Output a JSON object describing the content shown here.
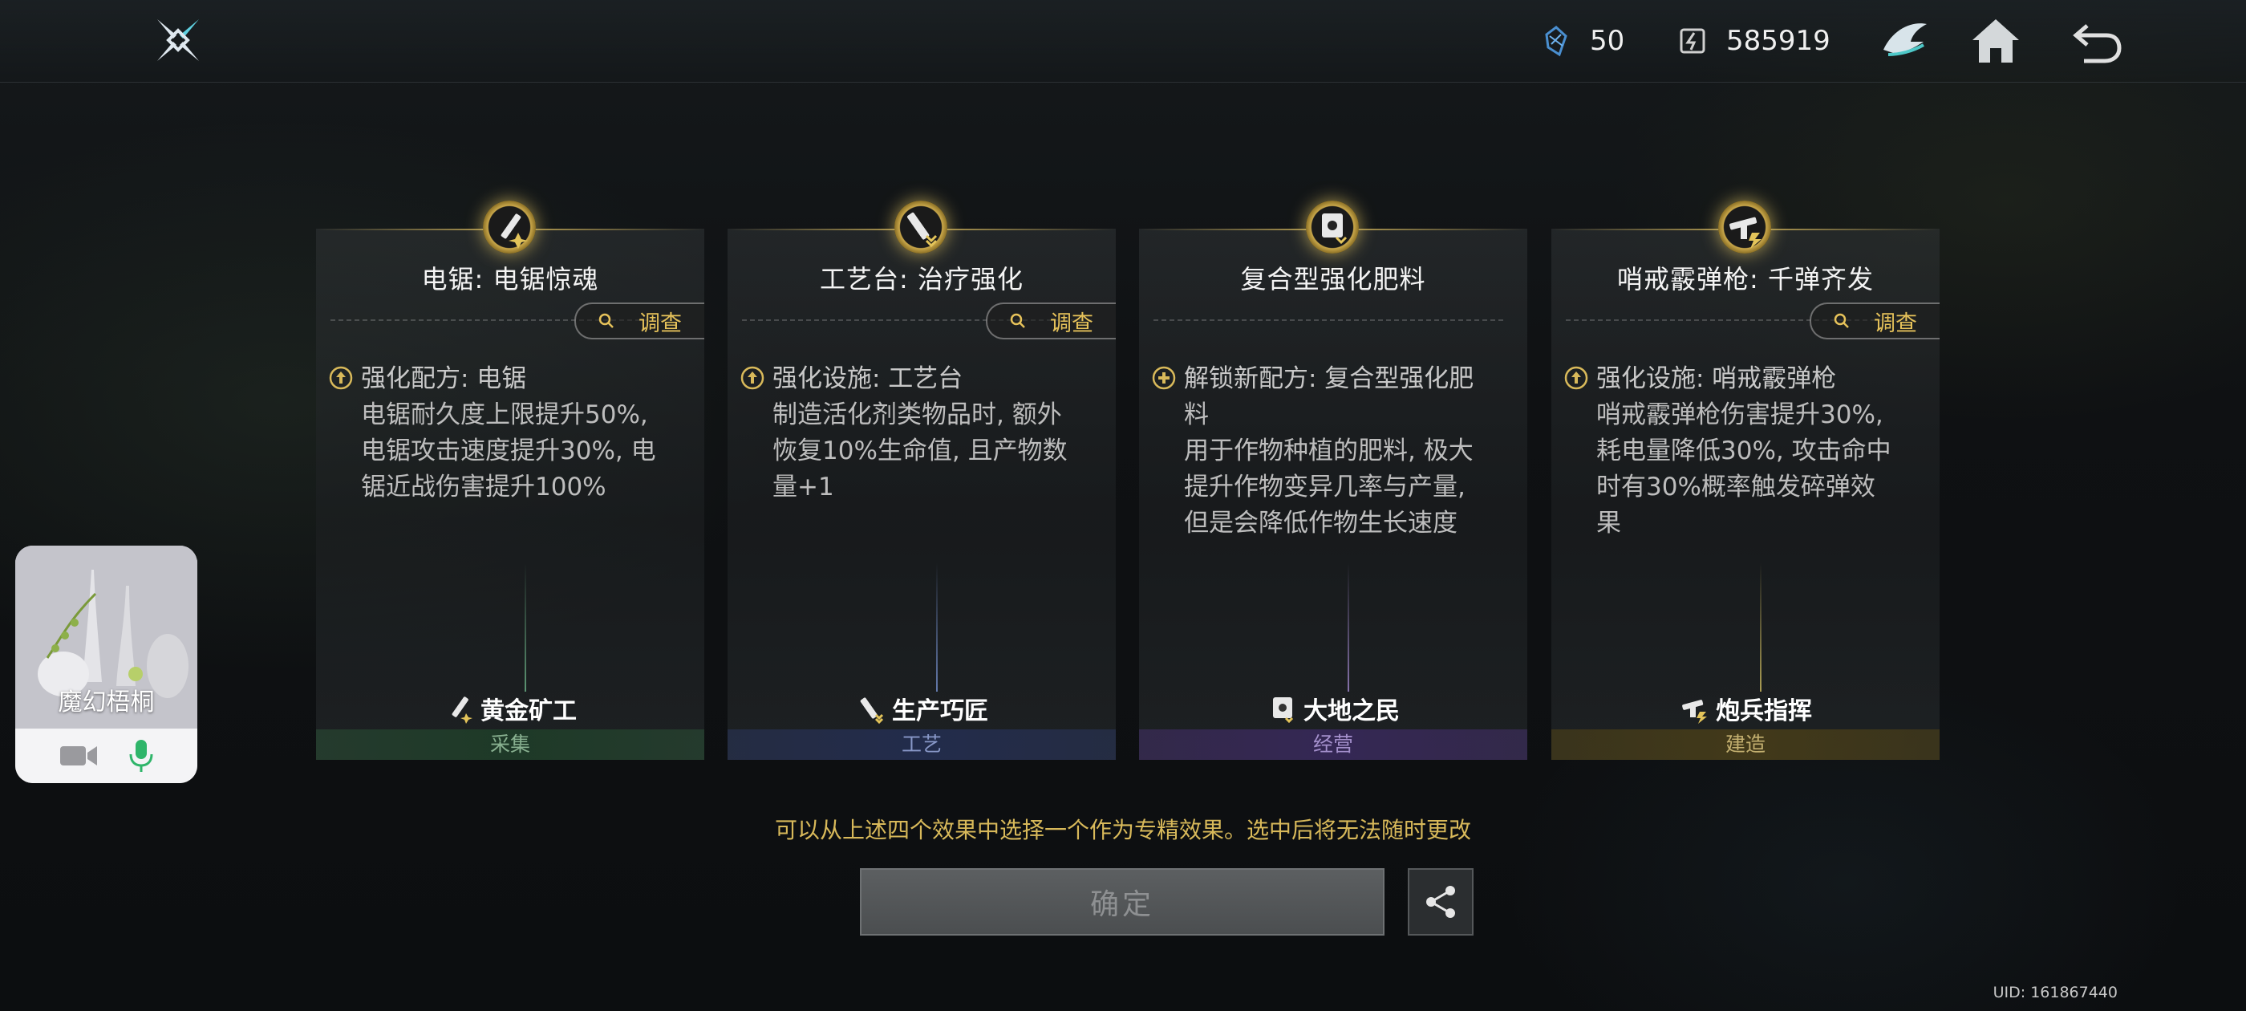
{
  "topbar": {
    "resource1_value": "50",
    "resource2_value": "585919"
  },
  "cards": [
    {
      "title": "电锯: 电锯惊魂",
      "investigate_label": "调查",
      "effect_head": "强化配方: 电锯",
      "effect_lines": [
        "电锯耐久度上限提升50%,",
        "电锯攻击速度提升30%, 电",
        "锯近战伤害提升100%"
      ],
      "role": "黄金矿工",
      "category": "采集",
      "category_color": "#88b090"
    },
    {
      "title": "工艺台: 治疗强化",
      "investigate_label": "调查",
      "effect_head": "强化设施: 工艺台",
      "effect_lines": [
        "制造活化剂类物品时, 额外",
        "恢复10%生命值, 且产物数",
        "量+1"
      ],
      "role": "生产巧匠",
      "category": "工艺",
      "category_color": "#8898c8"
    },
    {
      "title": "复合型强化肥料",
      "effect_head": "解锁新配方: 复合型强化肥",
      "effect_lines": [
        "料",
        "用于作物种植的肥料, 极大",
        "提升作物变异几率与产量,",
        "但是会降低作物生长速度"
      ],
      "role": "大地之民",
      "category": "经营",
      "category_color": "#a490cc"
    },
    {
      "title": "哨戒霰弹枪: 千弹齐发",
      "investigate_label": "调查",
      "effect_head": "强化设施: 哨戒霰弹枪",
      "effect_lines": [
        "哨戒霰弹枪伤害提升30%,",
        "耗电量降低30%, 攻击命中",
        "时有30%概率触发碎弹效",
        "果"
      ],
      "role": "炮兵指挥",
      "category": "建造",
      "category_color": "#c4b070"
    }
  ],
  "notice": "可以从上述四个效果中选择一个作为专精效果。选中后将无法随时更改",
  "confirm_label": "确定",
  "uid": "UID: 161867440",
  "call_widget": {
    "name": "魔幻梧桐"
  },
  "colors": {
    "accent_gold": "#d8b95a",
    "investigate_gold": "#e6c25a"
  }
}
